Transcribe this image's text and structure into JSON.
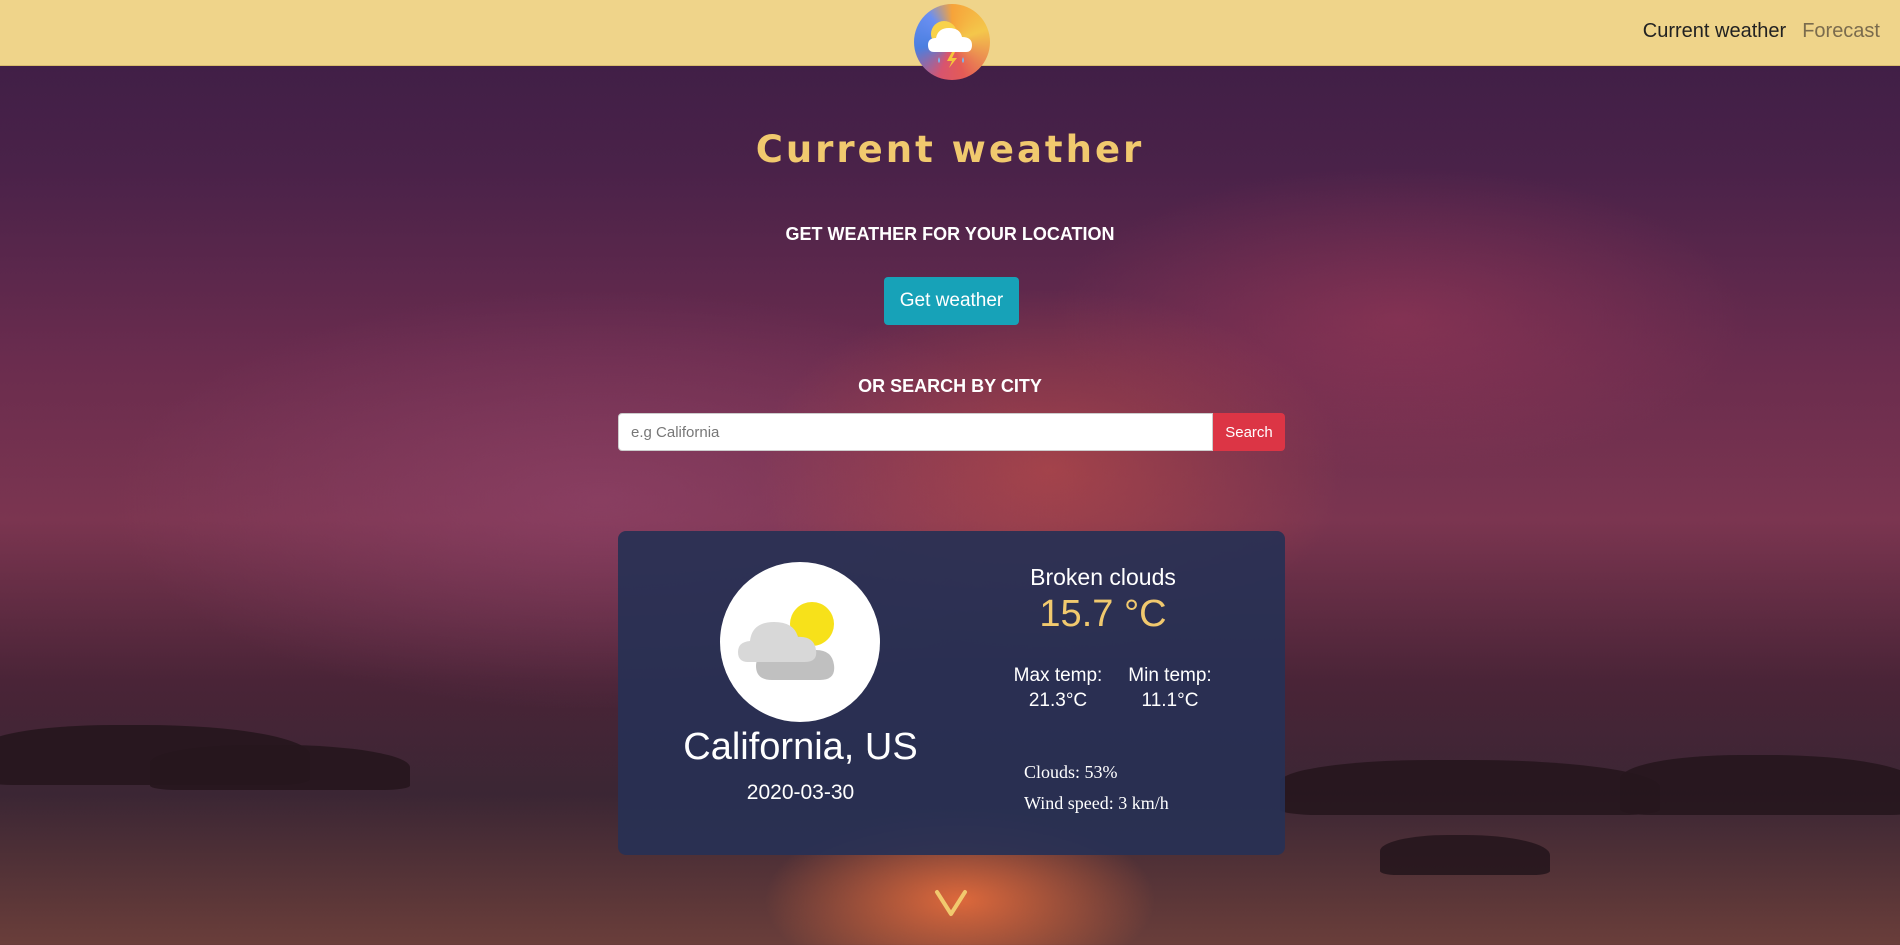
{
  "nav": {
    "logo_icon": "weather-app-logo",
    "links": [
      {
        "label": "Current weather",
        "active": true
      },
      {
        "label": "Forecast",
        "active": false
      }
    ]
  },
  "page": {
    "title": "Current weather",
    "location_heading": "GET WEATHER FOR YOUR LOCATION",
    "get_weather_label": "Get weather",
    "search_heading": "OR SEARCH BY CITY",
    "search_placeholder": "e.g California",
    "search_value": "",
    "search_label": "Search"
  },
  "weather": {
    "icon": "broken-clouds-icon",
    "city": "California, US",
    "date": "2020-03-30",
    "description": "Broken clouds",
    "temperature": "15.7 °C",
    "max_label": "Max temp:",
    "max_value": "21.3°C",
    "min_label": "Min temp:",
    "min_value": "11.1°C",
    "clouds": "Clouds: 53%",
    "wind": "Wind speed: 3 km/h"
  },
  "scroll_icon": "chevron-down-icon",
  "colors": {
    "navbar": "#efd48a",
    "accent_gold": "#f1c96e",
    "button_teal": "#17a2b8",
    "button_red": "#dc3545",
    "card_bg": "#283054"
  }
}
